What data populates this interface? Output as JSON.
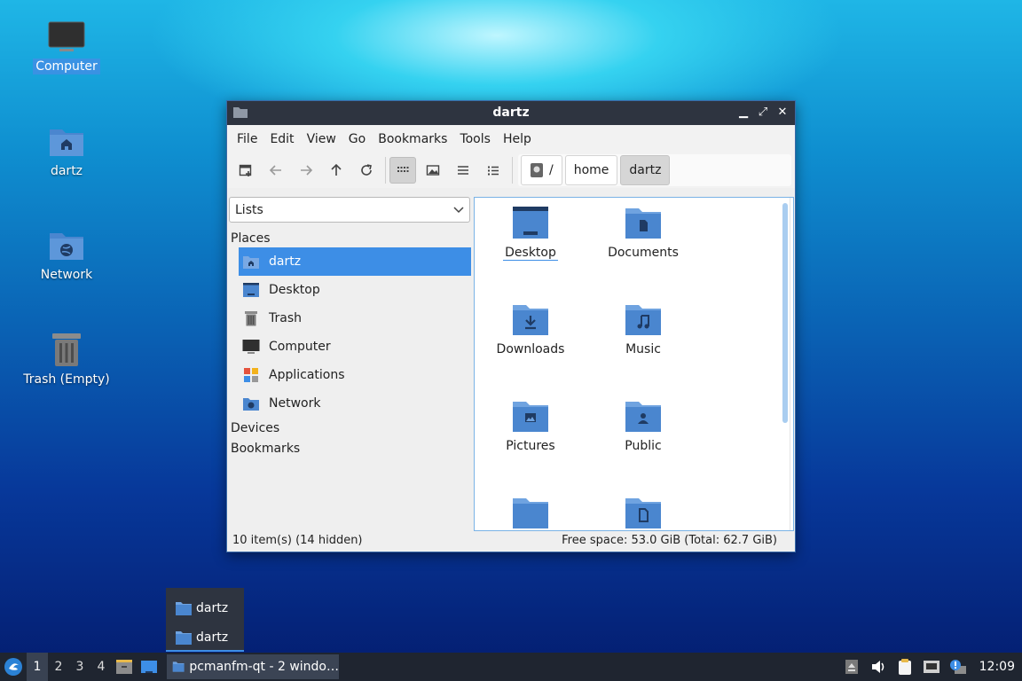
{
  "desktop": {
    "icons": [
      {
        "label": "Computer"
      },
      {
        "label": "dartz"
      },
      {
        "label": "Network"
      },
      {
        "label": "Trash (Empty)"
      }
    ]
  },
  "window": {
    "title": "dartz",
    "buttons": {
      "minimize": "▁",
      "maximize": "⤢",
      "close": "✕"
    }
  },
  "menubar": [
    "File",
    "Edit",
    "View",
    "Go",
    "Bookmarks",
    "Tools",
    "Help"
  ],
  "breadcrumb": [
    "/",
    "home",
    "dartz"
  ],
  "sidepane": {
    "selector": "Lists",
    "places_header": "Places",
    "places": [
      {
        "label": "dartz"
      },
      {
        "label": "Desktop"
      },
      {
        "label": "Trash"
      },
      {
        "label": "Computer"
      },
      {
        "label": "Applications"
      },
      {
        "label": "Network"
      }
    ],
    "devices_header": "Devices",
    "bookmarks_header": "Bookmarks"
  },
  "files": [
    {
      "label": "Desktop"
    },
    {
      "label": "Documents"
    },
    {
      "label": "Downloads"
    },
    {
      "label": "Music"
    },
    {
      "label": "Pictures"
    },
    {
      "label": "Public"
    }
  ],
  "status": {
    "left": "10 item(s) (14 hidden)",
    "right": "Free space: 53.0 GiB (Total: 62.7 GiB)"
  },
  "window_list": [
    "dartz",
    "dartz"
  ],
  "taskbar": {
    "workspaces": [
      "1",
      "2",
      "3",
      "4"
    ],
    "task_label": "pcmanfm-qt - 2 windo…",
    "clock": "12:09"
  },
  "colors": {
    "accent": "#3d8ee6",
    "folder": "#4a86cf",
    "folder_tab": "#6fa3e0"
  }
}
